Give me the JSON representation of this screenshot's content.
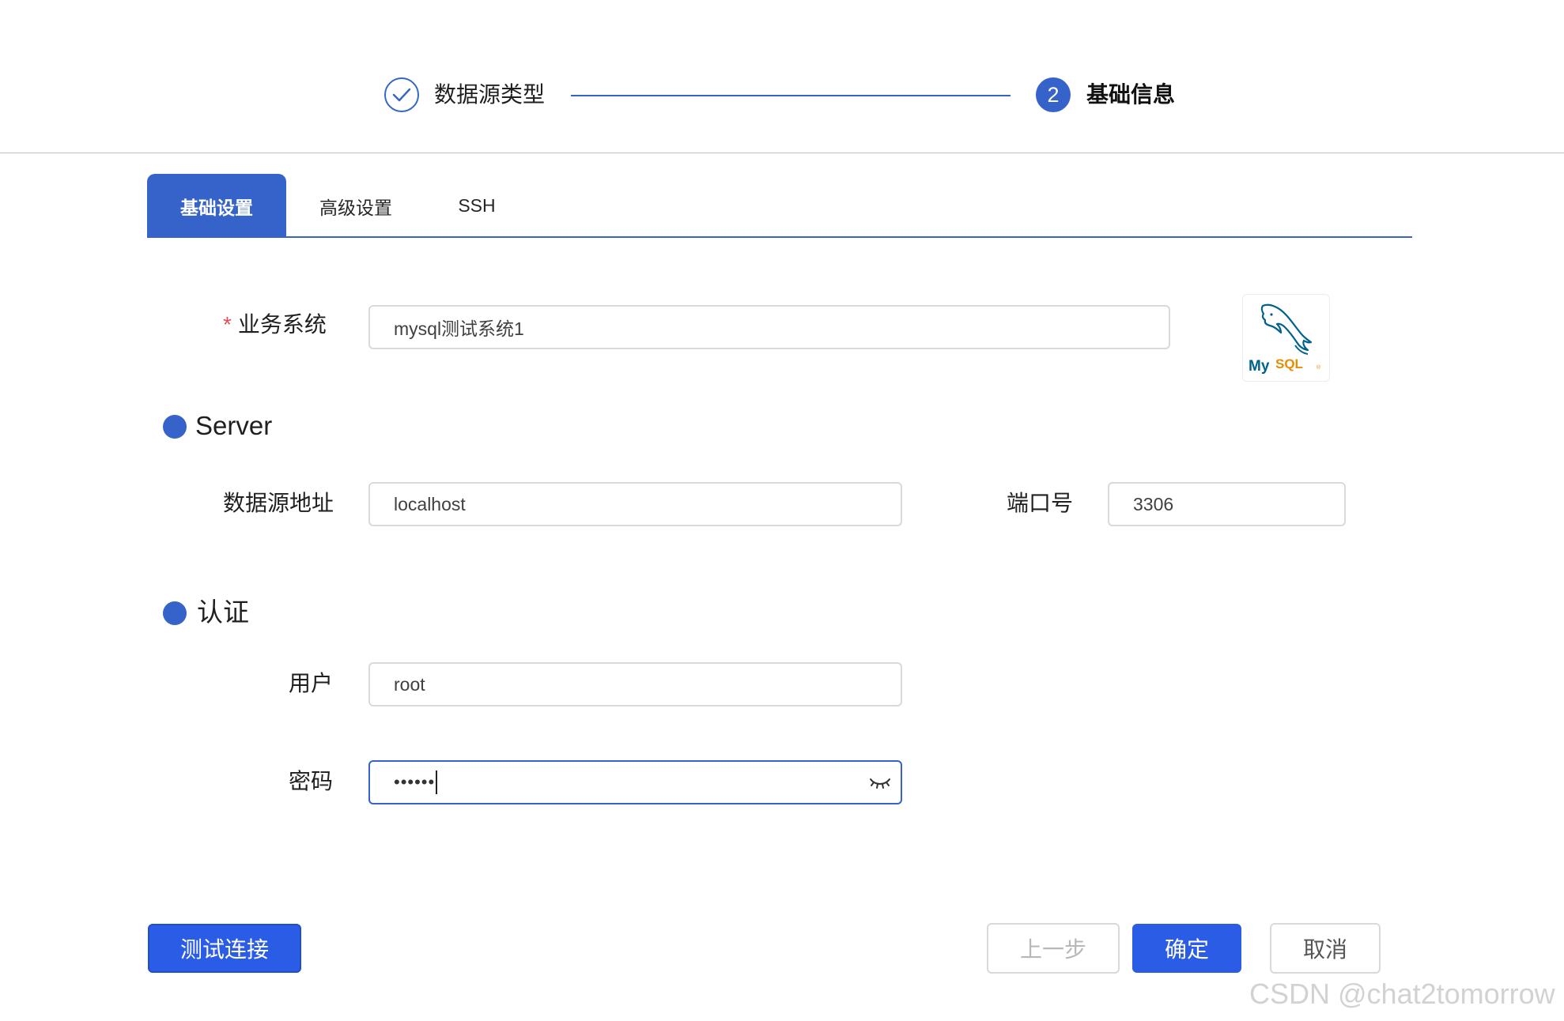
{
  "steps": [
    {
      "label": "数据源类型",
      "status": "done"
    },
    {
      "number": "2",
      "label": "基础信息",
      "status": "active"
    }
  ],
  "tabs": [
    {
      "label": "基础设置",
      "active": true
    },
    {
      "label": "高级设置",
      "active": false
    },
    {
      "label": "SSH",
      "active": false
    }
  ],
  "form": {
    "business_system": {
      "required_mark": "*",
      "label": "业务系统",
      "value": "mysql测试系统1"
    },
    "logo": {
      "text_my": "My",
      "text_sql": "SQL",
      "text_tm": "®"
    },
    "server_section": {
      "title": "Server"
    },
    "host": {
      "label": "数据源地址",
      "value": "localhost"
    },
    "port": {
      "label": "端口号",
      "value": "3306"
    },
    "auth_section": {
      "title": "认证"
    },
    "user": {
      "label": "用户",
      "value": "root"
    },
    "password": {
      "label": "密码",
      "masked_value": "••••••",
      "icon": "eye-closed-icon"
    }
  },
  "buttons": {
    "test": "测试连接",
    "prev": "上一步",
    "ok": "确定",
    "cancel": "取消"
  },
  "watermark": "CSDN @chat2tomorrow",
  "colors": {
    "accent": "#3563c9",
    "primary_button": "#2b5ce6",
    "required": "#e34d59",
    "logo_blue": "#00618a",
    "logo_orange": "#e48e00"
  }
}
